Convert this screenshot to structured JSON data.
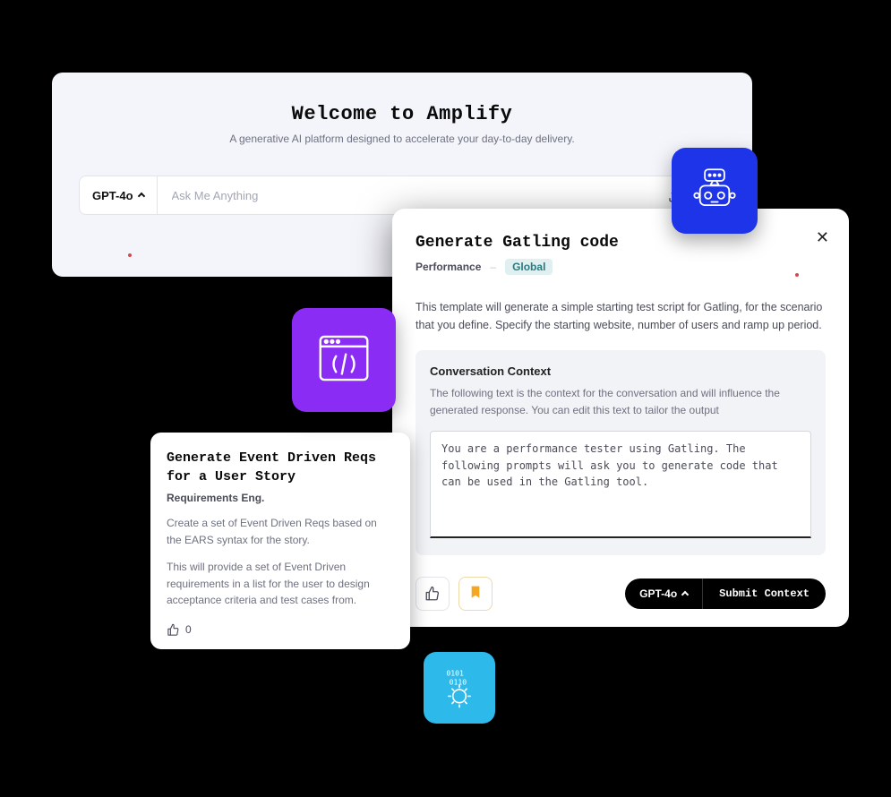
{
  "hero": {
    "title": "Welcome to Amplify",
    "subtitle": "A generative AI platform designed to accelerate your day-to-day delivery.",
    "model_label": "GPT-4o",
    "input_placeholder": "Ask Me Anything"
  },
  "small_card": {
    "title": "Generate Event Driven Reqs for a User Story",
    "category": "Requirements Eng.",
    "p1": "Create a set of Event Driven Reqs based on the EARS syntax for the story.",
    "p2": "This will provide a set of Event Driven requirements in a list for the user to design acceptance criteria and test cases from.",
    "upvote_count": "0"
  },
  "modal": {
    "title": "Generate Gatling code",
    "tag_performance": "Performance",
    "tag_global": "Global",
    "description": "This template will generate a simple starting test script for Gatling, for the scenario that you define. Specify the starting website, number of users and ramp up period.",
    "context_title": "Conversation Context",
    "context_help": "The following text is the context for the conversation and will influence the generated response. You can edit this text to tailor the output",
    "context_value": "You are a performance tester using Gatling. The following prompts will ask you to generate code that can be used in the Gatling tool.",
    "footer_model": "GPT-4o",
    "submit_label": "Submit Context"
  }
}
